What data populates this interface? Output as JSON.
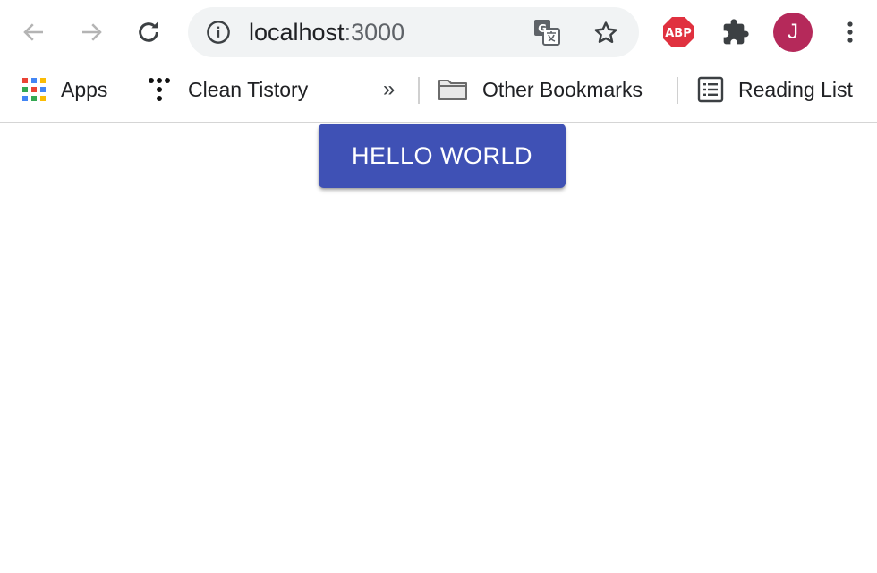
{
  "browser": {
    "url_host": "localhost",
    "url_port": ":3000",
    "profile_initial": "J",
    "adblock_label": "ABP"
  },
  "bookmarks": {
    "apps": "Apps",
    "clean_tistory": "Clean Tistory",
    "overflow": "»",
    "other_bookmarks": "Other Bookmarks",
    "reading_list": "Reading List"
  },
  "page": {
    "button_label": "HELLO WORLD"
  },
  "colors": {
    "button_bg": "#3f51b5",
    "avatar_bg": "#b5295a",
    "adblock_red": "#e0313f"
  }
}
